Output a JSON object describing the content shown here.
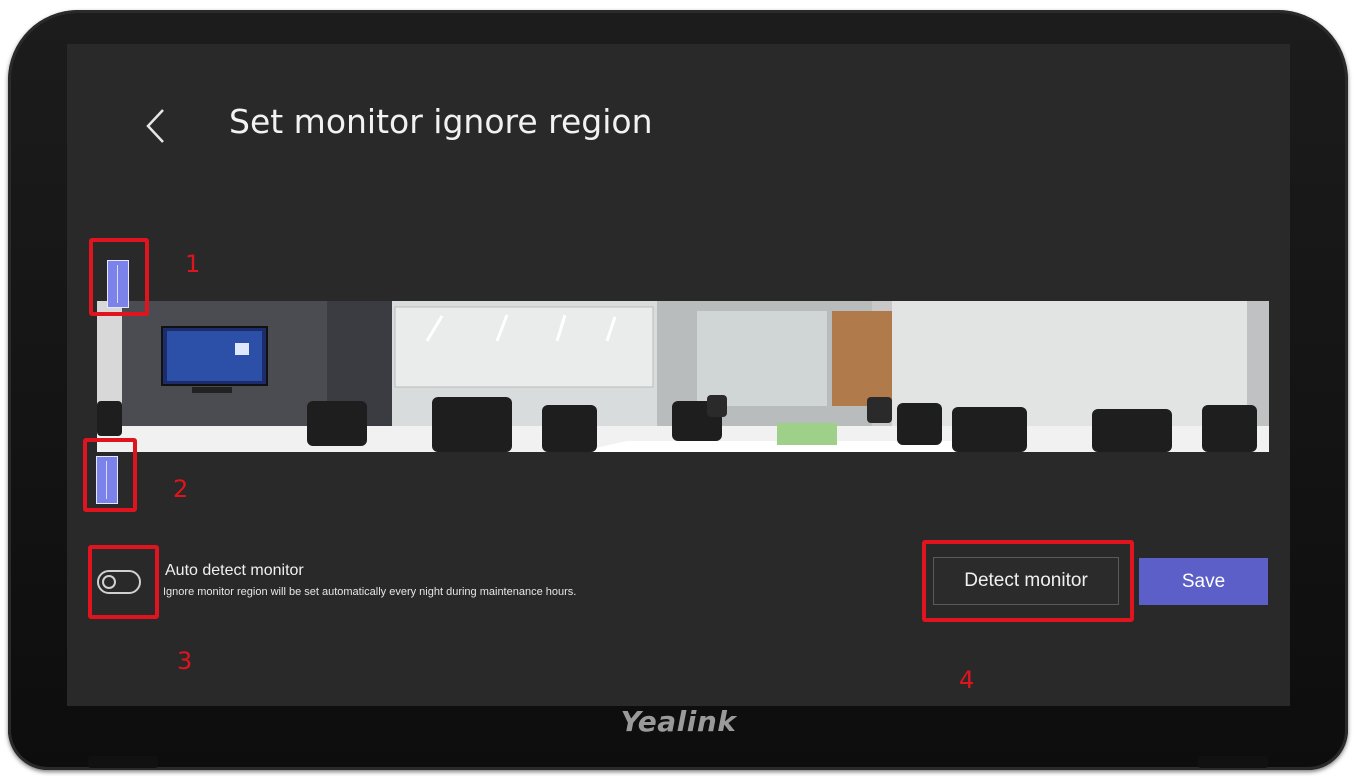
{
  "page": {
    "title": "Set monitor ignore region"
  },
  "icons": {
    "back": "chevron-left-icon"
  },
  "panorama": {
    "description_icon": "conference-room-panorama"
  },
  "auto_detect": {
    "label": "Auto detect monitor",
    "description": "Ignore monitor region will be set automatically every night during maintenance hours.",
    "enabled": false
  },
  "buttons": {
    "detect": "Detect monitor",
    "save": "Save"
  },
  "callouts": [
    "1",
    "2",
    "3",
    "4"
  ],
  "device": {
    "brand": "Yealink"
  },
  "colors": {
    "accent": "#5b5fc7",
    "handle": "#7b83eb",
    "callout": "#e0141e",
    "screen_bg": "#292929"
  }
}
